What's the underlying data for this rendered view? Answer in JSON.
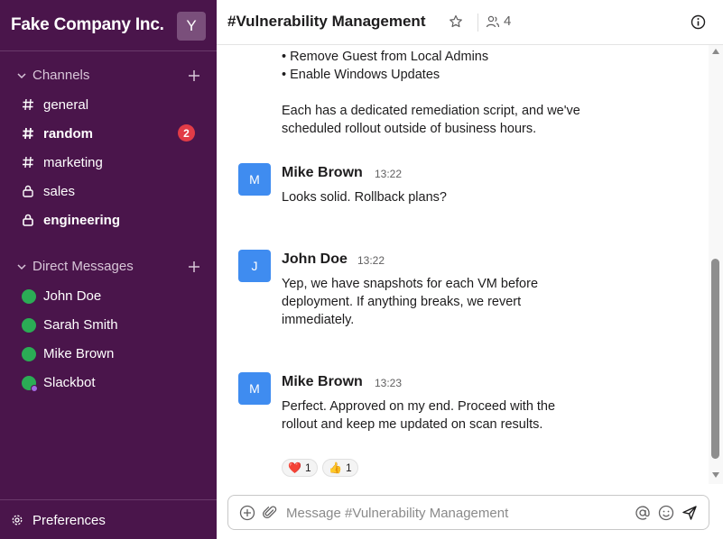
{
  "workspace": {
    "name": "Fake Company Inc.",
    "avatar_initial": "Y"
  },
  "sidebar": {
    "channels_label": "Channels",
    "channels": [
      {
        "name": "general",
        "icon": "hash-icon",
        "bold": false
      },
      {
        "name": "random",
        "icon": "hash-icon",
        "bold": true,
        "badge": "2"
      },
      {
        "name": "marketing",
        "icon": "hash-icon",
        "bold": false
      },
      {
        "name": "sales",
        "icon": "lock-icon",
        "bold": false
      },
      {
        "name": "engineering",
        "icon": "lock-icon",
        "bold": true
      }
    ],
    "dm_label": "Direct Messages",
    "dms": [
      {
        "name": "John Doe",
        "status": "online"
      },
      {
        "name": "Sarah Smith",
        "status": "online"
      },
      {
        "name": "Mike Brown",
        "status": "online"
      },
      {
        "name": "Slackbot",
        "status": "bot"
      }
    ],
    "preferences_label": "Preferences"
  },
  "header": {
    "channel_title": "#Vulnerability Management",
    "member_count": "4"
  },
  "messages": {
    "top_lines": [
      "• Remove Guest from Local Admins",
      "• Enable Windows Updates"
    ],
    "top_paragraph": [
      "Each has a dedicated remediation script, and we've",
      "scheduled rollout outside of business hours."
    ],
    "list": [
      {
        "initial": "M",
        "author": "Mike Brown",
        "time": "13:22",
        "lines": [
          "Looks solid. Rollback plans?"
        ]
      },
      {
        "initial": "J",
        "author": "John Doe",
        "time": "13:22",
        "lines": [
          "Yep, we have snapshots for each VM before",
          "deployment. If anything breaks, we revert",
          "immediately."
        ]
      },
      {
        "initial": "M",
        "author": "Mike Brown",
        "time": "13:23",
        "lines": [
          "Perfect. Approved on my end. Proceed with the",
          "rollout and keep me updated on scan results."
        ]
      }
    ],
    "reactions": [
      {
        "emoji": "❤️",
        "count": "1"
      },
      {
        "emoji": "👍",
        "count": "1"
      }
    ]
  },
  "composer": {
    "placeholder": "Message #Vulnerability Management"
  },
  "colors": {
    "sidebar_bg": "#4a154b",
    "avatar_blue": "#3f8cf0",
    "badge_red": "#e23c47",
    "presence_green": "#2bac55"
  }
}
